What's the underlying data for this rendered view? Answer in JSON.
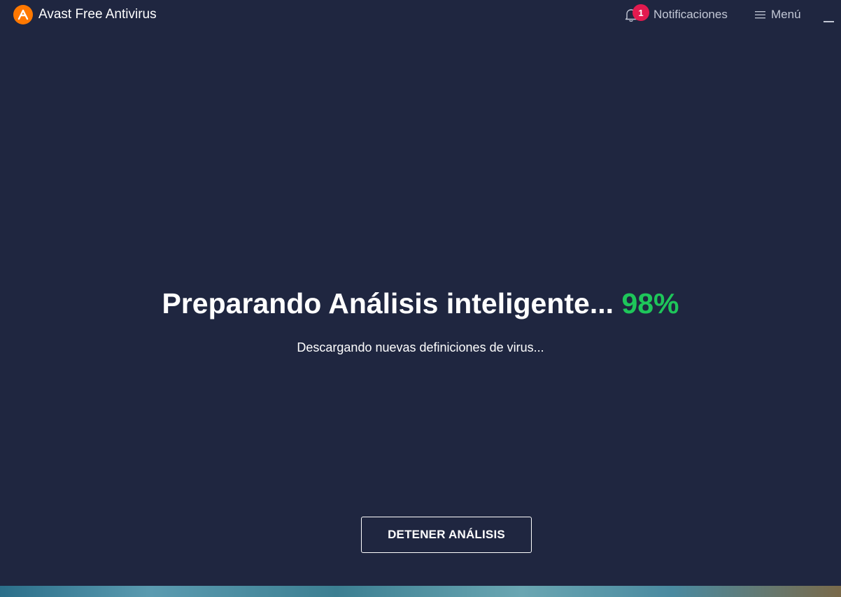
{
  "app": {
    "title": "Avast Free Antivirus",
    "logo_icon": "avast-logo-icon",
    "accent_color": "#ff7800"
  },
  "header": {
    "notifications": {
      "label": "Notificaciones",
      "badge_count": "1",
      "icon": "bell-icon",
      "badge_color": "#e21a4f"
    },
    "menu": {
      "label": "Menú",
      "icon": "hamburger-icon"
    },
    "window_controls": {
      "minimize_icon": "minimize-icon"
    }
  },
  "main": {
    "status_text": "Preparando Análisis inteligente...",
    "progress_text": "98%",
    "progress_percent": 98,
    "progress_color": "#1ec65a",
    "detail_text": "Descargando nuevas definiciones de virus...",
    "stop_button_label": "DETENER ANÁLISIS"
  },
  "theme": {
    "background": "#1f2640",
    "text": "#ffffff"
  }
}
